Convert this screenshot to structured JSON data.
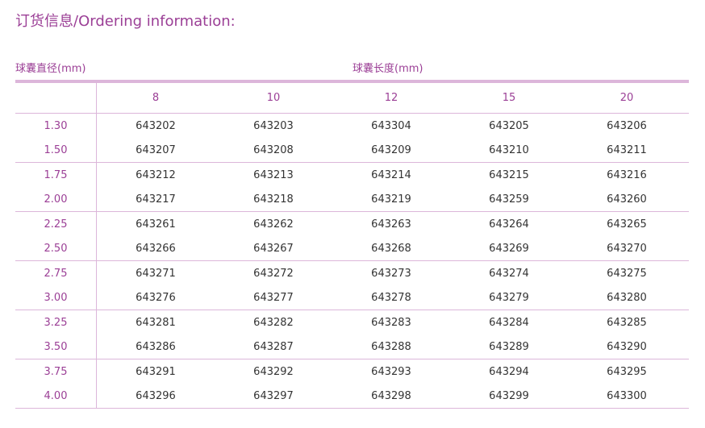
{
  "title": "订货信息/Ordering information:",
  "label_diameter": "球囊直径(mm)",
  "label_length": "球囊长度(mm)",
  "lengths": [
    "8",
    "10",
    "12",
    "15",
    "20"
  ],
  "rows": [
    {
      "d": "1.30",
      "c": [
        "643202",
        "643203",
        "643304",
        "643205",
        "643206"
      ]
    },
    {
      "d": "1.50",
      "c": [
        "643207",
        "643208",
        "643209",
        "643210",
        "643211"
      ]
    },
    {
      "d": "1.75",
      "c": [
        "643212",
        "643213",
        "643214",
        "643215",
        "643216"
      ]
    },
    {
      "d": "2.00",
      "c": [
        "643217",
        "643218",
        "643219",
        "643259",
        "643260"
      ]
    },
    {
      "d": "2.25",
      "c": [
        "643261",
        "643262",
        "643263",
        "643264",
        "643265"
      ]
    },
    {
      "d": "2.50",
      "c": [
        "643266",
        "643267",
        "643268",
        "643269",
        "643270"
      ]
    },
    {
      "d": "2.75",
      "c": [
        "643271",
        "643272",
        "643273",
        "643274",
        "643275"
      ]
    },
    {
      "d": "3.00",
      "c": [
        "643276",
        "643277",
        "643278",
        "643279",
        "643280"
      ]
    },
    {
      "d": "3.25",
      "c": [
        "643281",
        "643282",
        "643283",
        "643284",
        "643285"
      ]
    },
    {
      "d": "3.50",
      "c": [
        "643286",
        "643287",
        "643288",
        "643289",
        "643290"
      ]
    },
    {
      "d": "3.75",
      "c": [
        "643291",
        "643292",
        "643293",
        "643294",
        "643295"
      ]
    },
    {
      "d": "4.00",
      "c": [
        "643296",
        "643297",
        "643298",
        "643299",
        "643300"
      ]
    }
  ]
}
